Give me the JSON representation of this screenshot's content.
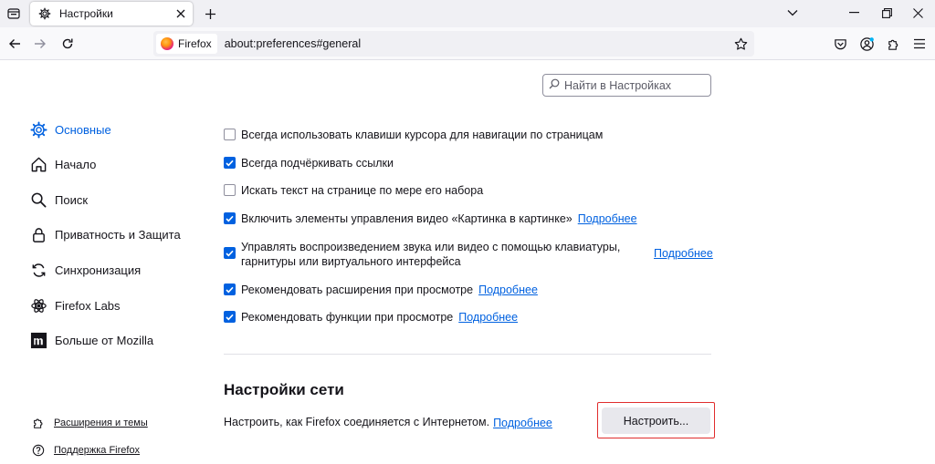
{
  "tab": {
    "title": "Настройки"
  },
  "urlbar": {
    "identity_label": "Firefox",
    "url": "about:preferences#general"
  },
  "search": {
    "placeholder": "Найти в Настройках"
  },
  "sidebar": {
    "items": [
      {
        "label": "Основные",
        "icon": "gear-icon",
        "selected": true
      },
      {
        "label": "Начало",
        "icon": "home-icon"
      },
      {
        "label": "Поиск",
        "icon": "search-icon"
      },
      {
        "label": "Приватность и Защита",
        "icon": "lock-icon"
      },
      {
        "label": "Синхронизация",
        "icon": "sync-icon"
      },
      {
        "label": "Firefox Labs",
        "icon": "labs-icon"
      },
      {
        "label": "Больше от Mozilla",
        "icon": "mozilla-icon"
      }
    ],
    "footer": [
      {
        "label": "Расширения и темы",
        "icon": "puzzle-icon"
      },
      {
        "label": "Поддержка Firefox",
        "icon": "help-icon"
      }
    ]
  },
  "options": [
    {
      "label": "Всегда использовать клавиши курсора для навигации по страницам",
      "checked": false
    },
    {
      "label": "Всегда подчёркивать ссылки",
      "checked": true
    },
    {
      "label": "Искать текст на странице по мере его набора",
      "checked": false
    },
    {
      "label": "Включить элементы управления видео «Картинка в картинке»",
      "checked": true,
      "learn_more": "Подробнее"
    },
    {
      "label_line1": "Управлять воспроизведением звука или видео с помощью клавиатуры,",
      "label_line2": "гарнитуры или виртуального интерфейса",
      "checked": true,
      "learn_more": "Подробнее"
    },
    {
      "label": "Рекомендовать расширения при просмотре",
      "checked": true,
      "learn_more": "Подробнее"
    },
    {
      "label": "Рекомендовать функции при просмотре",
      "checked": true,
      "learn_more": "Подробнее"
    }
  ],
  "network": {
    "title": "Настройки сети",
    "description": "Настроить, как Firefox соединяется с Интернетом.",
    "learn_more": "Подробнее",
    "button": "Настроить..."
  },
  "colors": {
    "accent": "#0061e0",
    "focus_outline": "#e02d2d"
  }
}
